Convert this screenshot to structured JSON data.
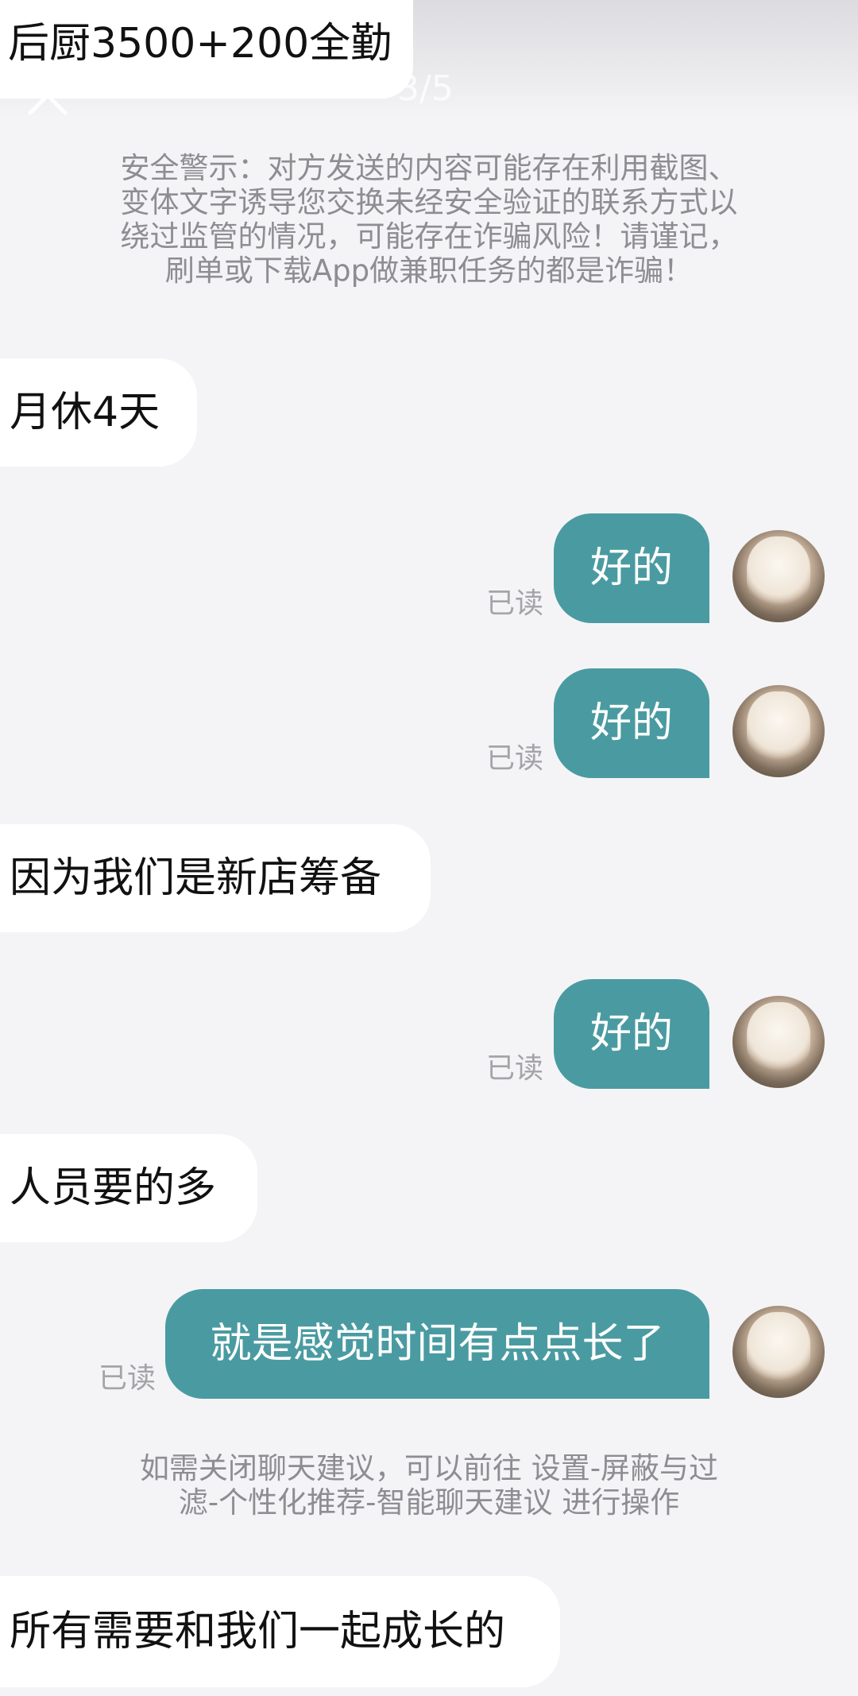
{
  "viewer": {
    "page_indicator": "3/5"
  },
  "safety_notice": {
    "lines": [
      "安全警示：对方发送的内容可能存在利用截图、",
      "变体文字诱导您交换未经安全验证的联系方式以",
      "绕过监管的情况，可能存在诈骗风险！请谨记，",
      "刷单或下载App做兼职任务的都是诈骗！"
    ]
  },
  "messages": [
    {
      "direction": "in",
      "text": "后厨3500+200全勤"
    },
    {
      "direction": "in",
      "text": "月休4天"
    },
    {
      "direction": "out",
      "text": "好的",
      "status": "已读"
    },
    {
      "direction": "out",
      "text": "好的",
      "status": "已读"
    },
    {
      "direction": "in",
      "text": "因为我们是新店筹备"
    },
    {
      "direction": "out",
      "text": "好的",
      "status": "已读"
    },
    {
      "direction": "in",
      "text": "人员要的多"
    },
    {
      "direction": "out",
      "text": "就是感觉时间有点点长了",
      "status": "已读"
    },
    {
      "direction": "in",
      "text": "所有需要和我们一起成长的"
    }
  ],
  "suggestion_notice": {
    "lines": [
      "如需关闭聊天建议，可以前往 设置-屏蔽与过",
      "滤-个性化推荐-智能聊天建议 进行操作"
    ]
  },
  "icons": {
    "close": "close-icon",
    "avatar": "avatar"
  },
  "colors": {
    "background": "#f4f4f6",
    "outgoing_bubble": "#4a9ba1",
    "incoming_bubble": "#ffffff",
    "notice_text": "#8d8d92",
    "read_status": "#a4a4a8"
  }
}
